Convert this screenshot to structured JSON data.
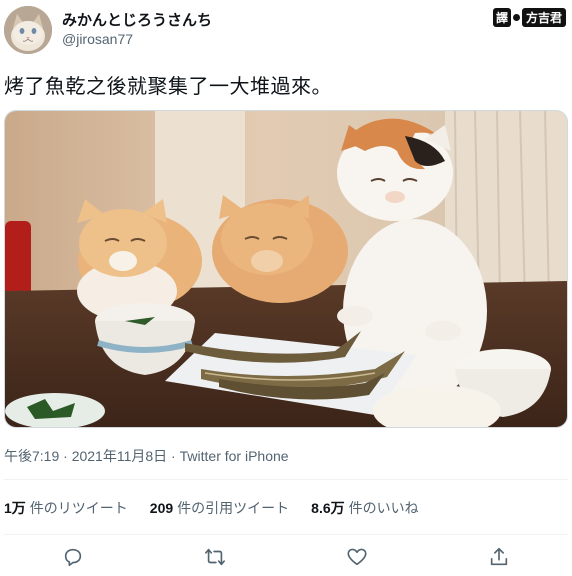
{
  "user": {
    "display_name": "みかんとじろうさんち",
    "handle": "@jirosan77",
    "avatar": "cat-avatar"
  },
  "badge": {
    "left": "譯",
    "right": "方吉君"
  },
  "tweet": {
    "text": "烤了魚乾之後就聚集了一大堆過來。",
    "image": "three-cats-looking-at-grilled-fish-on-table"
  },
  "meta": {
    "time": "午後7:19",
    "separator1": " · ",
    "date": "2021年11月8日",
    "separator2": " · ",
    "source": "Twitter for iPhone"
  },
  "stats": [
    {
      "count": "1万",
      "label": "件のリツイート"
    },
    {
      "count": "209",
      "label": "件の引用ツイート"
    },
    {
      "count": "8.6万",
      "label": "件のいいね"
    }
  ],
  "actions": [
    {
      "name": "reply-icon"
    },
    {
      "name": "retweet-icon"
    },
    {
      "name": "like-icon"
    },
    {
      "name": "share-icon"
    }
  ],
  "colors": {
    "text": "#0f1419",
    "secondary": "#536471",
    "divider": "#eff3f4"
  }
}
